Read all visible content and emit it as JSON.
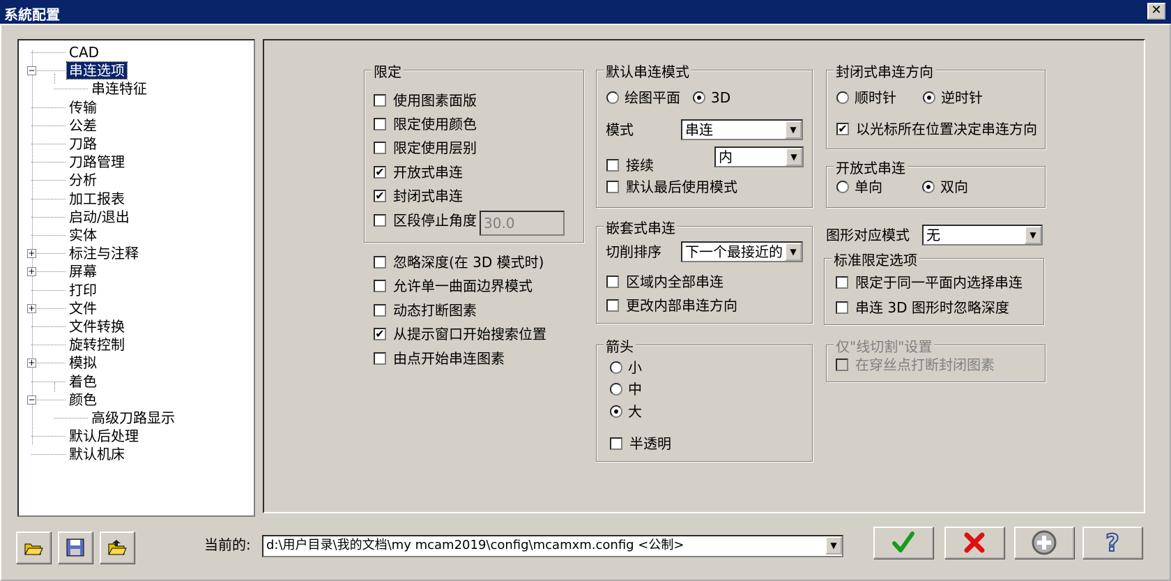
{
  "window": {
    "title": "系統配置",
    "close": "✕"
  },
  "tree": {
    "items": [
      {
        "label": "CAD"
      },
      {
        "label": "串连选项",
        "expander": "⊟"
      },
      {
        "label": "串连特征"
      },
      {
        "label": "传输"
      },
      {
        "label": "公差"
      },
      {
        "label": "刀路"
      },
      {
        "label": "刀路管理"
      },
      {
        "label": "分析"
      },
      {
        "label": "加工报表"
      },
      {
        "label": "启动/退出"
      },
      {
        "label": "实体"
      },
      {
        "label": "标注与注释",
        "expander": "⊞"
      },
      {
        "label": "屏幕",
        "expander": "⊞"
      },
      {
        "label": "打印"
      },
      {
        "label": "文件",
        "expander": "⊞"
      },
      {
        "label": "文件转换"
      },
      {
        "label": "旋转控制"
      },
      {
        "label": "模拟",
        "expander": "⊞"
      },
      {
        "label": "着色"
      },
      {
        "label": "颜色",
        "expander": "⊟"
      },
      {
        "label": "高级刀路显示"
      },
      {
        "label": "默认后处理"
      },
      {
        "label": "默认机床"
      }
    ]
  },
  "limits": {
    "title": "限定",
    "use_entity_mask": {
      "label": "使用图素面版",
      "checked": false
    },
    "limit_color": {
      "label": "限定使用颜色",
      "checked": false
    },
    "limit_level": {
      "label": "限定使用层别",
      "checked": false
    },
    "open_chain": {
      "label": "开放式串连",
      "checked": true
    },
    "closed_chain": {
      "label": "封闭式串连",
      "checked": true
    },
    "partial_angle": {
      "label": "区段停止角度",
      "checked": false,
      "value": "30.0"
    }
  },
  "misc": {
    "ignore_depth": {
      "label": "忽略深度(在 3D 模式时)",
      "checked": false
    },
    "single_surface": {
      "label": "允许单一曲面边界模式",
      "checked": false
    },
    "dynamic_break": {
      "label": "动态打断图素",
      "checked": false
    },
    "search_from_prompt": {
      "label": "从提示窗口开始搜索位置",
      "checked": true
    },
    "start_from_point": {
      "label": "由点开始串连图素",
      "checked": false
    }
  },
  "default_chain": {
    "title": "默认串连模式",
    "plane": {
      "label": "绘图平面",
      "selected": false
    },
    "d3": {
      "label": "3D",
      "selected": true
    },
    "mode_label": "模式",
    "mode_value": "串连",
    "wait": {
      "label": "接续",
      "checked": false
    },
    "wait_value": "内",
    "use_last": {
      "label": "默认最后使用模式",
      "checked": false
    }
  },
  "nested": {
    "title": "嵌套式串连",
    "order_label": "切削排序",
    "order_value": "下一个最接近的",
    "all_in_region": {
      "label": "区域内全部串连",
      "checked": false
    },
    "reverse_inner": {
      "label": "更改内部串连方向",
      "checked": false
    }
  },
  "arrow": {
    "title": "箭头",
    "small": {
      "label": "小",
      "selected": false
    },
    "medium": {
      "label": "中",
      "selected": false
    },
    "large": {
      "label": "大",
      "selected": true
    },
    "translucent": {
      "label": "半透明",
      "checked": false
    }
  },
  "closed_dir": {
    "title": "封闭式串连方向",
    "cw": {
      "label": "顺时针",
      "selected": false
    },
    "ccw": {
      "label": "逆时针",
      "selected": true
    },
    "cursor_dir": {
      "label": "以光标所在位置决定串连方向",
      "checked": true
    }
  },
  "open_chain": {
    "title": "开放式串连",
    "one_way": {
      "label": "单向",
      "selected": false
    },
    "two_way": {
      "label": "双向",
      "selected": true
    }
  },
  "graphics_match": {
    "label": "图形对应模式",
    "value": "无"
  },
  "standard": {
    "title": "标准限定选项",
    "same_plane": {
      "label": "限定于同一平面内选择串连",
      "checked": false
    },
    "ignore_depth_3d": {
      "label": "串连 3D 图形时忽略深度",
      "checked": false
    }
  },
  "wire": {
    "title": "仅\"线切割\"设置",
    "break_closed": {
      "label": "在穿丝点打断封闭图素",
      "checked": false
    }
  },
  "footer": {
    "current_label": "当前的:",
    "current_value": "d:\\用户目录\\我的文档\\my mcam2019\\config\\mcamxm.config <公制>"
  },
  "colors": {
    "ok": "#1a9a1a",
    "cancel": "#e01010",
    "add": "#808080",
    "help": "#3050a0"
  }
}
